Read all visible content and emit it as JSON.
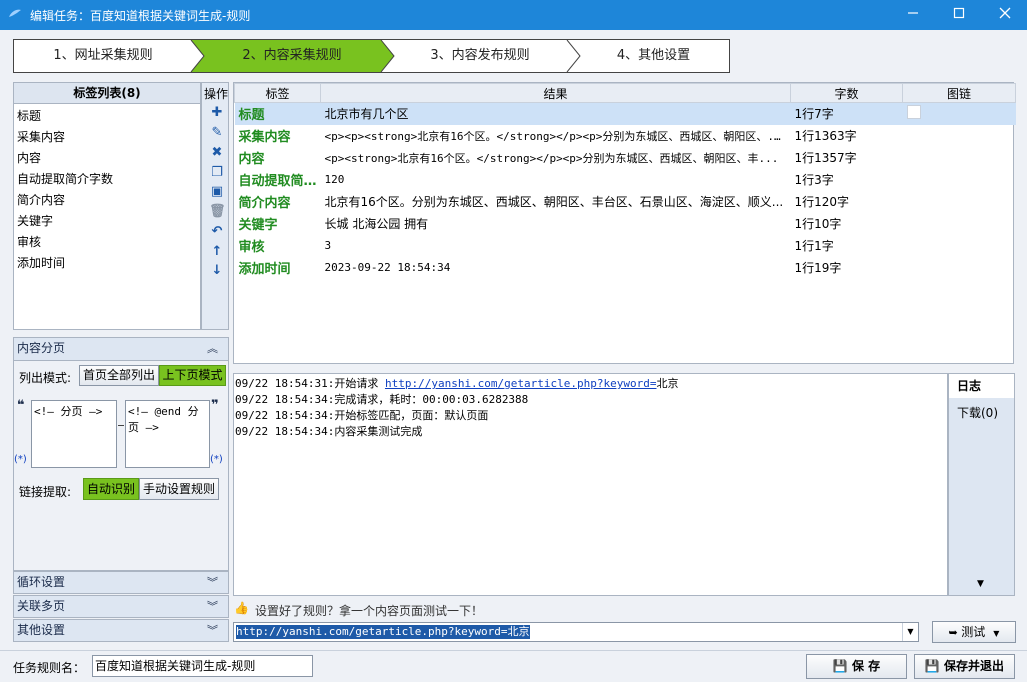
{
  "window": {
    "title": "编辑任务：百度知道根据关键词生成-规则"
  },
  "wizard": {
    "steps": [
      "1、网址采集规则",
      "2、内容采集规则",
      "3、内容发布规则",
      "4、其他设置"
    ],
    "active_index": 1
  },
  "tag_list": {
    "title": "标签列表(8)",
    "ops_title": "操作",
    "items": [
      "标题",
      "采集内容",
      "内容",
      "自动提取简介字数",
      "简介内容",
      "关键字",
      "审核",
      "添加时间"
    ]
  },
  "results": {
    "columns": [
      "标签",
      "结果",
      "字数",
      "图链"
    ],
    "rows": [
      {
        "tag": "标题",
        "result": "北京市有几个区",
        "count": "1行7字"
      },
      {
        "tag": "采集内容",
        "result": "<p><p><strong>北京有16个区。</strong></p><p>分别为东城区、西城区、朝阳区、...",
        "count": "1行1363字"
      },
      {
        "tag": "内容",
        "result": "<p><strong>北京有16个区。</strong></p><p>分别为东城区、西城区、朝阳区、丰...",
        "count": "1行1357字"
      },
      {
        "tag": "自动提取简…",
        "result": "120",
        "count": "1行3字"
      },
      {
        "tag": "简介内容",
        "result": "北京有16个区。分别为东城区、西城区、朝阳区、丰台区、石景山区、海淀区、顺义...",
        "count": "1行120字"
      },
      {
        "tag": "关键字",
        "result": "长城 北海公园 拥有",
        "count": "1行10字"
      },
      {
        "tag": "审核",
        "result": "3",
        "count": "1行1字"
      },
      {
        "tag": "添加时间",
        "result": "2023-09-22 18:54:34",
        "count": "1行19字"
      }
    ]
  },
  "paging": {
    "title": "内容分页",
    "mode_label": "列出模式:",
    "mode_all": "首页全部列出",
    "mode_prev_next": "上下页模式",
    "start_marker": "<!— 分页 —>",
    "end_marker": "<!— @end 分页 —>",
    "quote_open": "❝",
    "quote_close": "❞",
    "wildcard": "(*)",
    "link_label": "链接提取:",
    "link_auto": "自动识别",
    "link_manual": "手动设置规则"
  },
  "sections": {
    "loop": "循环设置",
    "multi": "关联多页",
    "other": "其他设置"
  },
  "log": {
    "lines": [
      {
        "time": "09/22 18:54:31:",
        "text": "开始请求 ",
        "link": "http://yanshi.com/getarticle.php?keyword=",
        "suffix": "北京"
      },
      {
        "time": "09/22 18:54:34:",
        "text": "完成请求，耗时：00:00:03.6282388"
      },
      {
        "time": "09/22 18:54:34:",
        "text": "开始标签匹配，页面：默认页面"
      },
      {
        "time": "09/22 18:54:34:",
        "text": "内容采集测试完成"
      }
    ]
  },
  "side_tabs": {
    "log": "日志",
    "download": "下载(0)"
  },
  "test": {
    "hint": "设置好了规则？拿一个内容页面测试一下！",
    "url": "http://yanshi.com/getarticle.php?keyword=北京",
    "button": "测试"
  },
  "footer": {
    "rule_label": "任务规则名：",
    "rule_name": "百度知道根据关键词生成-规则",
    "save": "保 存",
    "save_exit": "保存并退出"
  },
  "colors": {
    "titlebar": "#1e86d9",
    "active_step": "#79c21f",
    "tag_text": "#218c21"
  }
}
